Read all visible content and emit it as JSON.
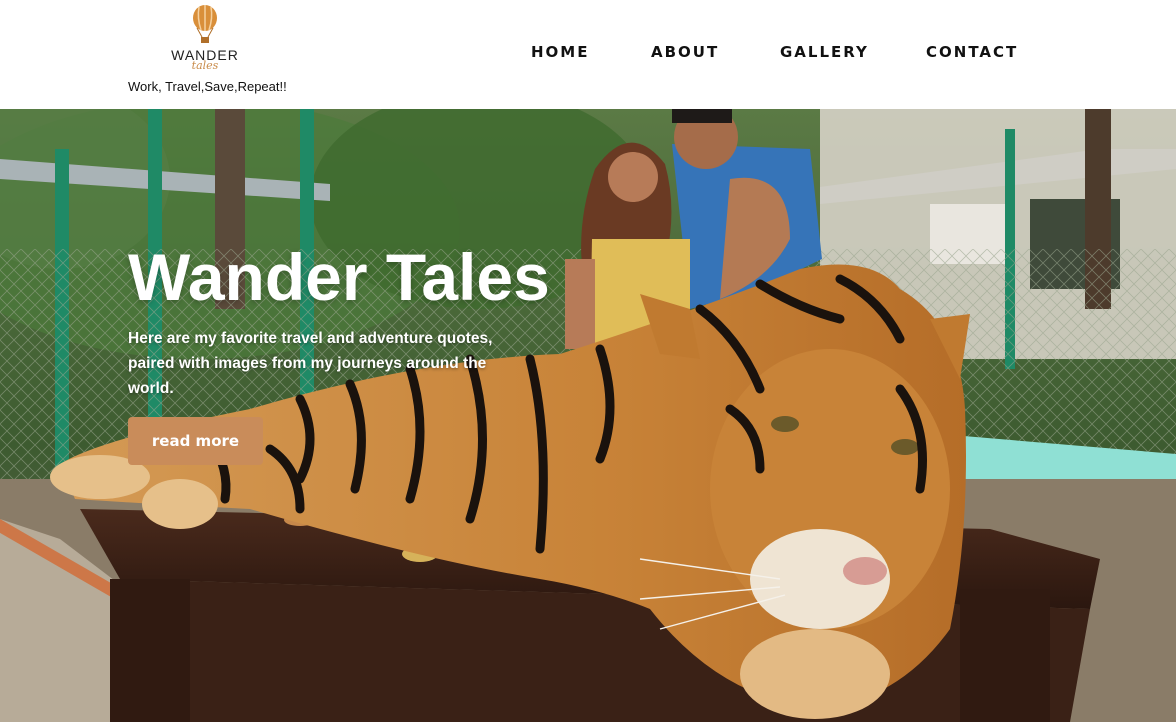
{
  "brand": {
    "logo_word": "WANDER",
    "logo_script": "tales",
    "tagline": "Work, Travel,Save,Repeat!!",
    "accent_color": "#c98c5a"
  },
  "nav": {
    "items": [
      {
        "label": "HOME"
      },
      {
        "label": "ABOUT"
      },
      {
        "label": "GALLERY"
      },
      {
        "label": "CONTACT"
      }
    ]
  },
  "hero": {
    "title": "Wander Tales",
    "subtitle": "Here are my favorite travel and adventure quotes, paired with images from my journeys around the world.",
    "button_label": "read more",
    "background_image": "tiger-lying-on-wooden-table-with-couple-photo"
  }
}
